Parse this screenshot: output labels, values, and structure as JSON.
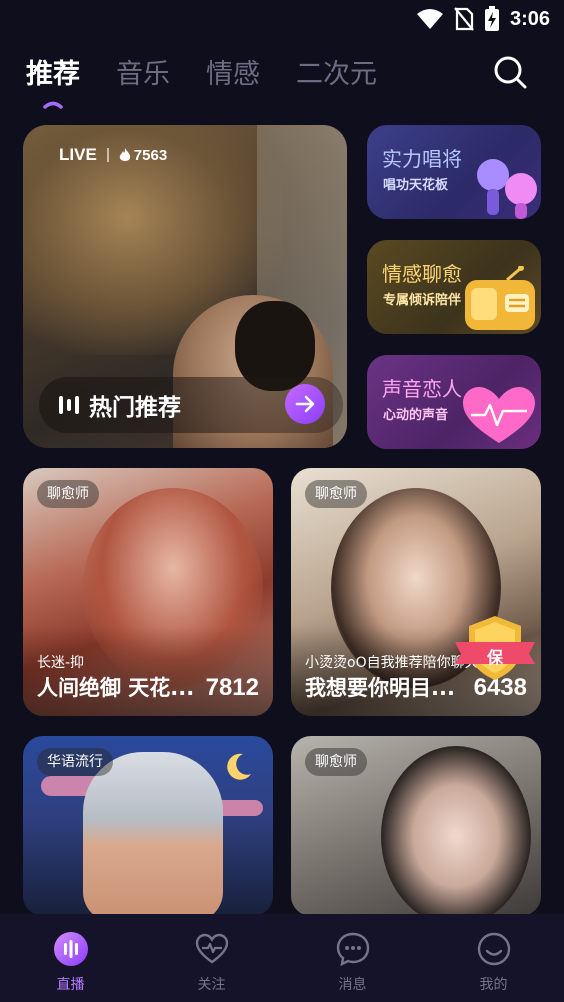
{
  "status_bar": {
    "time": "3:06"
  },
  "tabs": [
    {
      "label": "推荐",
      "active": true
    },
    {
      "label": "音乐",
      "active": false
    },
    {
      "label": "情感",
      "active": false
    },
    {
      "label": "二次元",
      "active": false
    }
  ],
  "hero": {
    "live_label": "LIVE",
    "viewer_count": "7563",
    "title": "热门推荐"
  },
  "side_cards": [
    {
      "title": "实力唱将",
      "subtitle": "唱功天花板"
    },
    {
      "title": "情感聊愈",
      "subtitle": "专属倾诉陪伴"
    },
    {
      "title": "声音恋人",
      "subtitle": "心动的声音"
    }
  ],
  "grid": [
    {
      "tag": "聊愈师",
      "subtitle": "长迷-抑",
      "name": "人间绝御 天花...",
      "count": "7812"
    },
    {
      "tag": "聊愈师",
      "subtitle": "小烫烫oO自我推荐陪你聊天",
      "name": "我想要你明目...",
      "count": "6438",
      "badge": "保"
    },
    {
      "tag": "华语流行"
    },
    {
      "tag": "聊愈师"
    }
  ],
  "bottom_nav": [
    {
      "label": "直播",
      "icon": "live-icon",
      "active": true
    },
    {
      "label": "关注",
      "icon": "heart-pulse-icon",
      "active": false
    },
    {
      "label": "消息",
      "icon": "chat-bubble-icon",
      "active": false
    },
    {
      "label": "我的",
      "icon": "smile-face-icon",
      "active": false
    }
  ],
  "colors": {
    "background": "#0f0e1c",
    "accent": "#b77bff",
    "nav_bg": "#14132a"
  }
}
